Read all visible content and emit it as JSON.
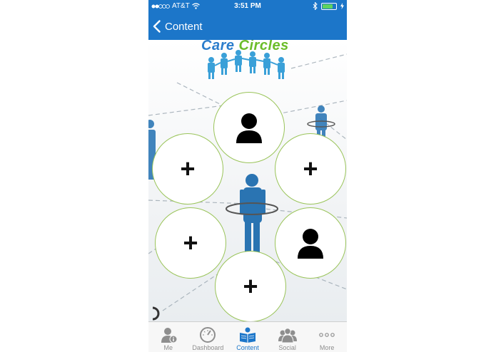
{
  "status_bar": {
    "carrier": "AT&T",
    "time": "3:51 PM"
  },
  "nav": {
    "back_label": "Content"
  },
  "logo": {
    "word1": "Care",
    "word2": "Circles"
  },
  "circles": [
    {
      "kind": "person"
    },
    {
      "kind": "plus",
      "label": "+"
    },
    {
      "kind": "plus",
      "label": "+"
    },
    {
      "kind": "plus",
      "label": "+"
    },
    {
      "kind": "person"
    },
    {
      "kind": "plus",
      "label": "+"
    }
  ],
  "tabs": [
    {
      "label": "Me",
      "icon": "me-icon",
      "active": false
    },
    {
      "label": "Dashboard",
      "icon": "dashboard-icon",
      "active": false
    },
    {
      "label": "Content",
      "icon": "content-icon",
      "active": true
    },
    {
      "label": "Social",
      "icon": "social-icon",
      "active": false
    },
    {
      "label": "More",
      "icon": "more-icon",
      "active": false
    }
  ],
  "colors": {
    "brand_blue": "#1c76c9",
    "logo_green": "#6bbd2a",
    "circle_border": "#9ac45a",
    "battery_green": "#5fd35f"
  }
}
